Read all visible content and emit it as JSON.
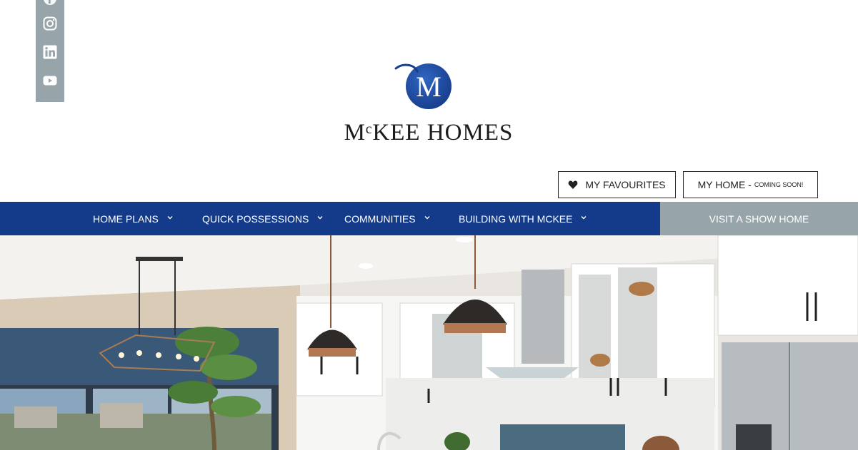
{
  "brand": {
    "name": "MᶜKEE HOMES",
    "logo_letter": "M",
    "colors": {
      "primary_blue": "#143a8a",
      "gray": "#97a5aa"
    }
  },
  "social": [
    {
      "name": "facebook-icon"
    },
    {
      "name": "instagram-icon"
    },
    {
      "name": "linkedin-icon"
    },
    {
      "name": "youtube-icon"
    }
  ],
  "header": {
    "favourites_label": "MY FAVOURITES",
    "favourites_icon": "heart-icon",
    "my_home_label": "MY HOME -",
    "my_home_note": "COMING SOON!"
  },
  "nav": {
    "items": [
      {
        "label": "HOME PLANS",
        "icon": "chevron-down-icon"
      },
      {
        "label": "QUICK POSSESSIONS",
        "icon": "chevron-down-icon"
      },
      {
        "label": "COMMUNITIES",
        "icon": "chevron-down-icon"
      },
      {
        "label": "BUILDING WITH MCKEE",
        "icon": "chevron-down-icon"
      }
    ],
    "cta_label": "VISIT A SHOW HOME"
  },
  "hero": {
    "image": "kitchen-photo"
  }
}
